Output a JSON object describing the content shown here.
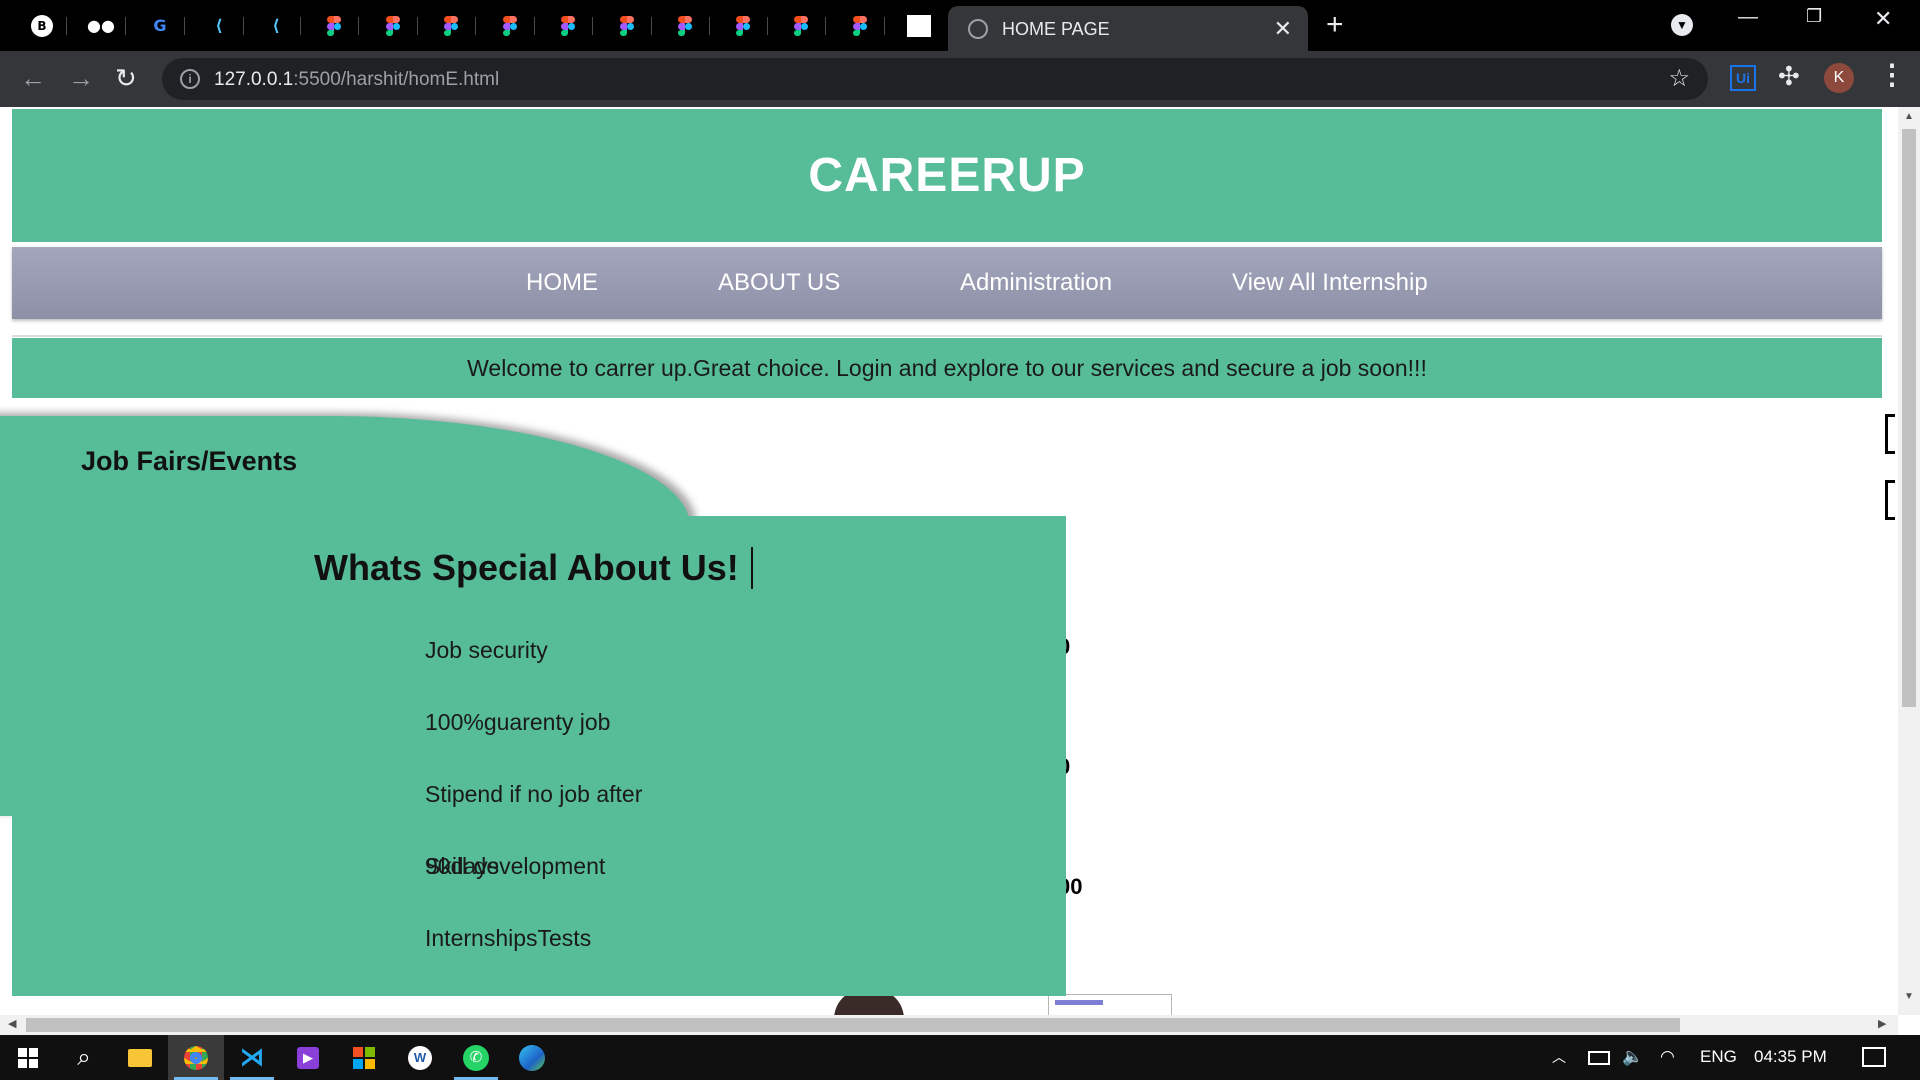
{
  "browser": {
    "active_tab_title": "HOME PAGE",
    "url_host": "127.0.0.1",
    "url_path": ":5500/harshit/homE.html",
    "profile_initial": "K",
    "extension_label": "Ui",
    "pinned_tabs": [
      "tab-a",
      "tab-b",
      "google",
      "flutter",
      "flutter",
      "figma",
      "figma",
      "figma",
      "figma",
      "figma",
      "figma",
      "figma",
      "figma",
      "figma",
      "figma",
      "image"
    ]
  },
  "site": {
    "title": "CAREERUP",
    "nav": [
      "HOME",
      "ABOUT US",
      "Administration",
      "View All Internship"
    ],
    "welcome": "Welcome to carrer up.Great choice. Login and explore to our services and secure a job soon!!!",
    "events_title": "Job Fairs/Events",
    "special": {
      "title": "Whats Special About Us!",
      "items": [
        "Job security",
        "100%guarenty job",
        "Stipend if no job after",
        "Skill development",
        "InternshipsTests"
      ],
      "overlap_text": "90days"
    },
    "obscured_text": [
      "0",
      "0",
      "00"
    ]
  },
  "taskbar": {
    "language": "ENG",
    "time": "04:35 PM"
  },
  "colors": {
    "accent_green": "#57bd98",
    "nav_gray": "#9a9db3",
    "chrome_dark": "#35363a"
  }
}
